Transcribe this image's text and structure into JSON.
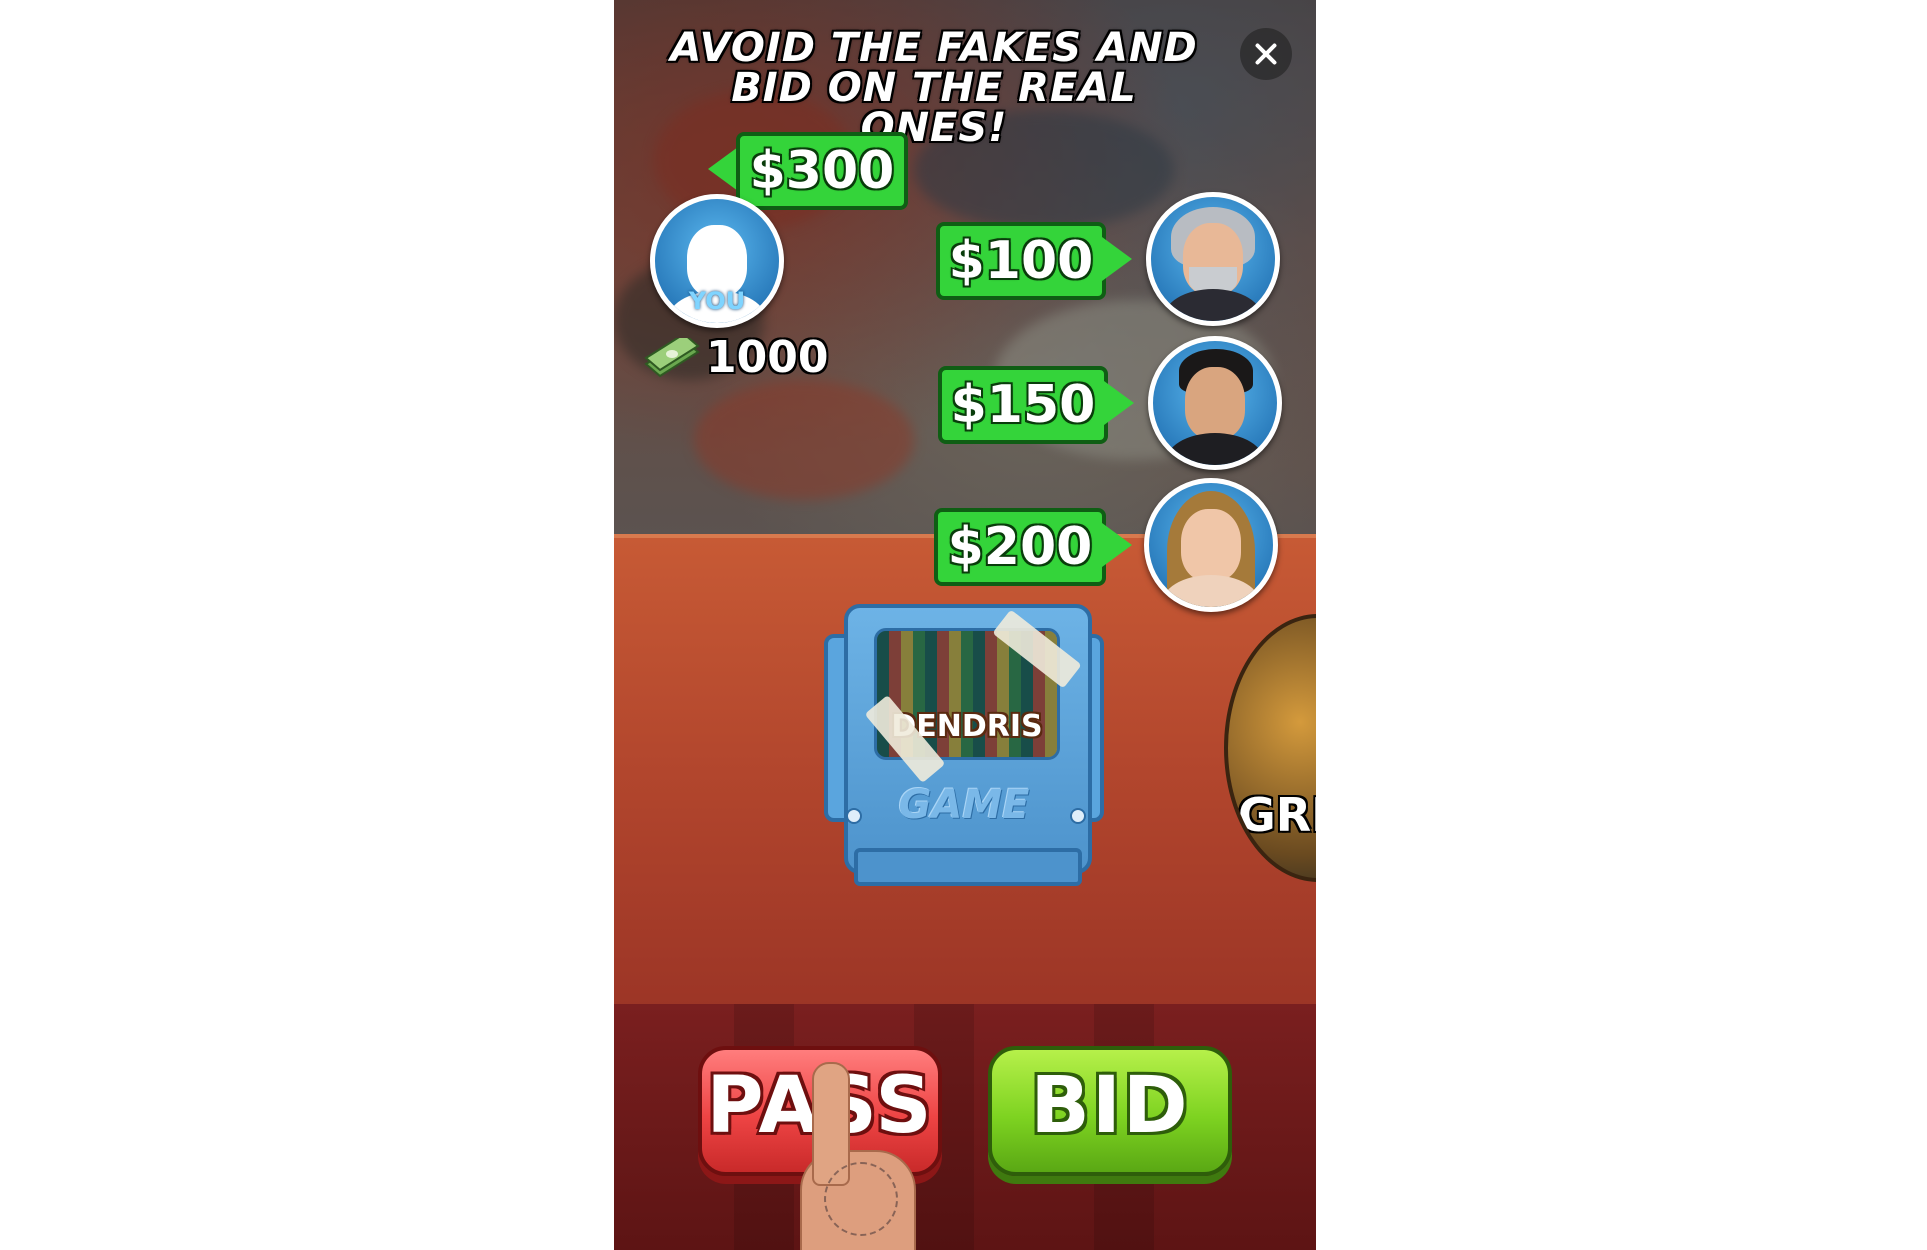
{
  "title": {
    "line1": "AVOID THE FAKES AND",
    "line2": "BID ON THE REAL ONES!"
  },
  "close_icon": "close-icon",
  "player": {
    "avatar_label": "YOU",
    "bid": "$300",
    "money": "1000",
    "money_icon": "cash-stack-icon"
  },
  "opponents": [
    {
      "name_icon": "old-man-avatar",
      "bid": "$100"
    },
    {
      "name_icon": "young-man-avatar",
      "bid": "$150"
    },
    {
      "name_icon": "woman-avatar",
      "bid": "$200"
    }
  ],
  "item": {
    "label": "DENDRIS",
    "brand": "GAME"
  },
  "next_item_partial_text": "GRI",
  "buttons": {
    "pass": "PASS",
    "bid": "BID"
  },
  "colors": {
    "bid_tag": "#34d43a",
    "pass_button": "#ee4444",
    "bid_button": "#7ed321",
    "table": "#b2462d"
  }
}
